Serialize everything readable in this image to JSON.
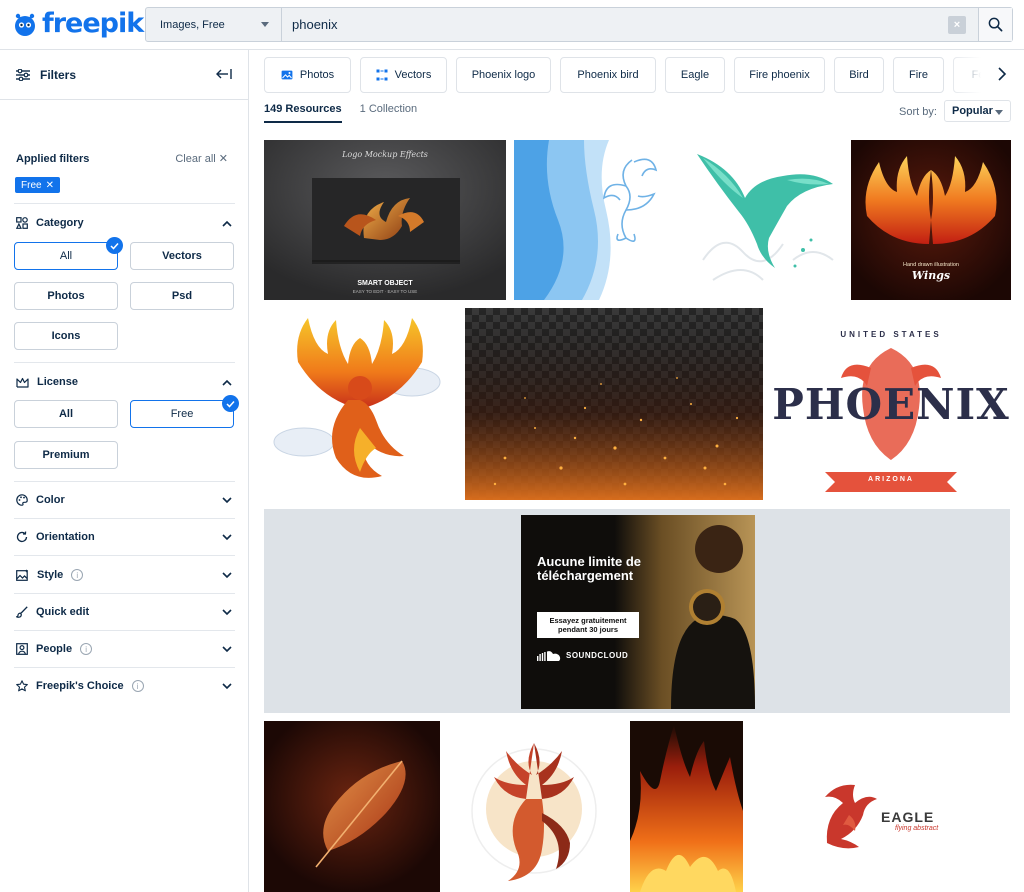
{
  "header": {
    "logo_text": "freepik",
    "type_select": "Images, Free",
    "search_value": "phoenix"
  },
  "sidebar": {
    "title": "Filters",
    "applied_label": "Applied filters",
    "clear_all": "Clear all",
    "applied_tag": "Free",
    "category": {
      "title": "Category",
      "options": [
        "All",
        "Vectors",
        "Photos",
        "Psd",
        "Icons"
      ],
      "selected": "All"
    },
    "license": {
      "title": "License",
      "options": [
        "All",
        "Free",
        "Premium"
      ],
      "selected": "Free"
    },
    "collapsed_sections": [
      "Color",
      "Orientation",
      "Style",
      "Quick edit",
      "People",
      "Freepik's Choice"
    ]
  },
  "chips": [
    "Photos",
    "Vectors",
    "Phoenix logo",
    "Phoenix bird",
    "Eagle",
    "Fire phoenix",
    "Bird",
    "Fire",
    "Fe"
  ],
  "tabs": {
    "resources": "149 Resources",
    "collections": "1 Collection"
  },
  "sort": {
    "label": "Sort by:",
    "value": "Popular"
  },
  "thumbnails": {
    "t1_line1": "Logo Mockup Effects",
    "t1_line2": "SMART OBJECT",
    "t1_line3": "EASY TO EDIT · EASY TO USE",
    "t4_line1": "Hand drawn illustration",
    "t4_line2": "Wings",
    "t7_top": "UNITED STATES",
    "t7_main": "PHOENIX",
    "t7_ribbon": "ARIZONA",
    "t11_main": "EAGLE",
    "t11_sub": "flying abstract"
  },
  "ad": {
    "headline": "Aucune limite de téléchargement",
    "cta": "Essayez gratuitement pendant 30 jours",
    "brand": "SOUNDCLOUD"
  },
  "colors": {
    "accent": "#1273eb",
    "text": "#0e2a47",
    "border": "#dfe3e8"
  }
}
